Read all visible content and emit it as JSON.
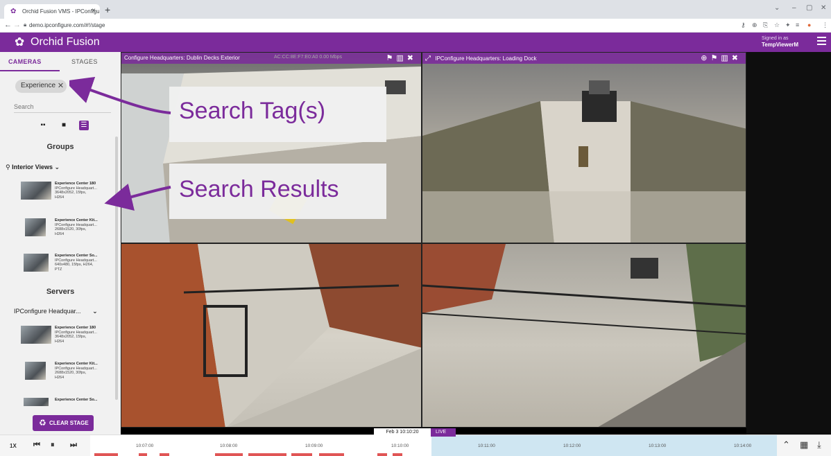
{
  "browser": {
    "tab_title": "Orchid Fusion VMS - IPConfigure",
    "url": "demo.ipconfigure.com/#!/stage"
  },
  "app": {
    "brand": "Orchid Fusion",
    "signed_in_label": "Signed in as",
    "user": "TempViewerM",
    "accent_color": "#7b2b9b"
  },
  "sidebar": {
    "tabs": [
      "CAMERAS",
      "STAGES"
    ],
    "search_tag": "Experience",
    "search_placeholder": "Search",
    "groups_title": "Groups",
    "group_name": "Interior Views",
    "group_items": [
      {
        "name": "Experience Center 180",
        "server": "IPConfigure Headquart...",
        "spec": "3648x2052, 15fps,",
        "codec": "H264"
      },
      {
        "name": "Experience Center Kit...",
        "server": "IPConfigure Headquart...",
        "spec": "2688x1520, 30fps,",
        "codec": "H264"
      },
      {
        "name": "Experience Center So...",
        "server": "IPConfigure Headquart...",
        "spec": "640x480, 15fps, H264,",
        "codec": "PTZ"
      }
    ],
    "servers_title": "Servers",
    "server_name": "IPConfigure Headquar...",
    "server_items": [
      {
        "name": "Experience Center 180",
        "server": "IPConfigure Headquart...",
        "spec": "3648x2052, 15fps,",
        "codec": "H264"
      },
      {
        "name": "Experience Center Kit...",
        "server": "IPConfigure Headquart...",
        "spec": "2688x1520, 30fps,",
        "codec": "H264"
      },
      {
        "name": "Experience Center So...",
        "server": "",
        "spec": "",
        "codec": ""
      }
    ],
    "clear_button": "CLEAR STAGE"
  },
  "tiles": [
    {
      "title": "Configure Headquarters: Dublin Decks Exterior",
      "overlay": "AC:CC:8E:F7:E0:A0   0.00 Mbps"
    },
    {
      "title": "IPConfigure Headquarters: Loading Dock"
    },
    {
      "title": ""
    },
    {
      "title": ""
    }
  ],
  "callouts": {
    "tags": "Search Tag(s)",
    "results": "Search Results"
  },
  "timeline": {
    "speed": "1X",
    "current_time": "Feb 3 10:10:20",
    "live_label": "LIVE",
    "ticks": [
      "10:07:00",
      "10:08:00",
      "10:09:00",
      "10:10:00",
      "10:11:00",
      "10:12:00",
      "10:13:00",
      "10:14:00"
    ]
  }
}
